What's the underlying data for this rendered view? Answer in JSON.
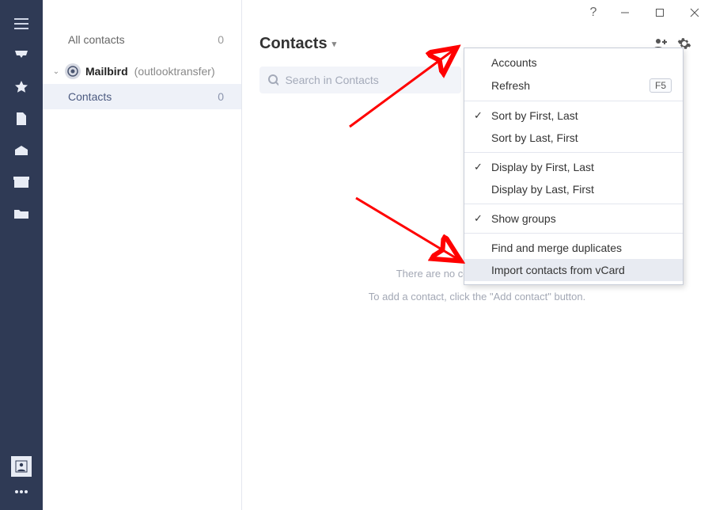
{
  "sidebar": {
    "tabs": [
      "menu",
      "inbox",
      "starred",
      "document",
      "outbox",
      "archive",
      "folder"
    ],
    "bottom": [
      "contacts",
      "more"
    ]
  },
  "titlebar": {
    "help": "?",
    "minimize": "_",
    "maximize": "□",
    "close": "×"
  },
  "left_panel": {
    "all": {
      "label": "All contacts",
      "count": "0"
    },
    "account": {
      "name": "Mailbird",
      "tag": "(outlooktransfer)"
    },
    "folder": {
      "label": "Contacts",
      "count": "0"
    }
  },
  "header": {
    "title": "Contacts",
    "add_tooltip": "Add contact",
    "settings_tooltip": "Settings"
  },
  "search": {
    "placeholder": "Search in Contacts"
  },
  "empty_state": {
    "line1": "There are no contacts in this group.",
    "line2": "To add a contact, click the \"Add contact\" button."
  },
  "menu": {
    "accounts": "Accounts",
    "refresh": {
      "label": "Refresh",
      "shortcut": "F5"
    },
    "sort_first_last": "Sort by First, Last",
    "sort_last_first": "Sort by Last, First",
    "display_first_last": "Display by First, Last",
    "display_last_first": "Display by Last, First",
    "show_groups": "Show groups",
    "find_merge": "Find and merge duplicates",
    "import_vcard": "Import contacts from vCard",
    "checked": {
      "sort_first_last": true,
      "display_first_last": true,
      "show_groups": true
    }
  },
  "annotations": {
    "arrow_to_gear": true,
    "arrow_to_import": true,
    "color": "#ff0000"
  }
}
